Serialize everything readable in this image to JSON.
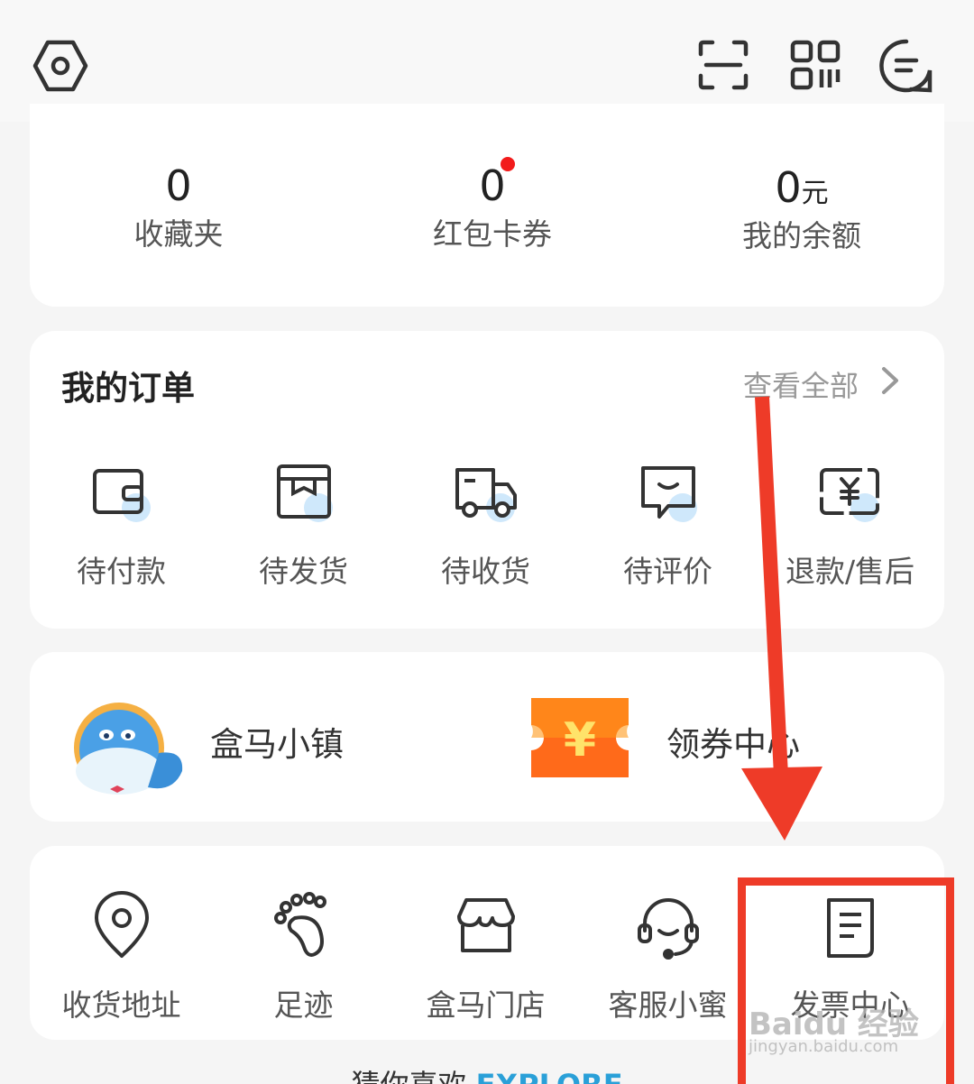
{
  "header": {
    "icons": [
      "settings-hex-icon",
      "scan-icon",
      "qrcode-icon",
      "message-icon"
    ]
  },
  "stats": [
    {
      "value": "0",
      "unit": "",
      "label": "收藏夹",
      "has_dot": false
    },
    {
      "value": "0",
      "unit": "",
      "label": "红包卡券",
      "has_dot": true
    },
    {
      "value": "0",
      "unit": "元",
      "label": "我的余额",
      "has_dot": false
    }
  ],
  "orders": {
    "title": "我的订单",
    "view_all": "查看全部",
    "items": [
      {
        "label": "待付款",
        "icon": "wallet-icon"
      },
      {
        "label": "待发货",
        "icon": "box-icon"
      },
      {
        "label": "待收货",
        "icon": "truck-icon"
      },
      {
        "label": "待评价",
        "icon": "comment-icon"
      },
      {
        "label": "退款/售后",
        "icon": "refund-icon"
      }
    ]
  },
  "promos": [
    {
      "label": "盒马小镇",
      "icon": "hippo-mascot-icon"
    },
    {
      "label": "领券中心",
      "icon": "coupon-ticket-icon"
    }
  ],
  "services": [
    {
      "label": "收货地址",
      "icon": "location-pin-icon"
    },
    {
      "label": "足迹",
      "icon": "footprint-icon"
    },
    {
      "label": "盒马门店",
      "icon": "store-icon"
    },
    {
      "label": "客服小蜜",
      "icon": "headset-icon"
    },
    {
      "label": "发票中心",
      "icon": "invoice-icon"
    }
  ],
  "guess": {
    "text": "猜你喜欢",
    "explore": "EXPLORE"
  },
  "watermark": {
    "text": "Baidu 经验",
    "sub": "jingyan.baidu.com"
  },
  "colors": {
    "accent_red": "#ee3b28",
    "badge_blue": "#cfe8fb",
    "coupon_orange": "#ff6a1a",
    "explore_blue": "#2aa0d8"
  }
}
